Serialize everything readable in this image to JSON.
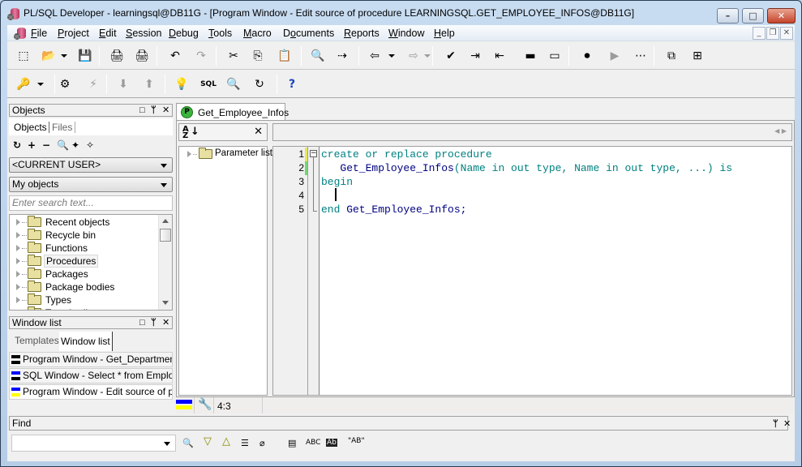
{
  "window": {
    "title": "PL/SQL Developer - learningsql@DB11G - [Program Window - Edit source of procedure LEARNINGSQL.GET_EMPLOYEE_INFOS@DB11G]",
    "controls": {
      "minimize": "–",
      "maximize": "□",
      "close": "✕"
    },
    "mdi_controls": {
      "minimize": "_",
      "restore": "❐",
      "close": "✕"
    }
  },
  "menu": {
    "items": [
      {
        "label": "File",
        "accel": "F"
      },
      {
        "label": "Project",
        "accel": "P"
      },
      {
        "label": "Edit",
        "accel": "E"
      },
      {
        "label": "Session",
        "accel": "S"
      },
      {
        "label": "Debug",
        "accel": "D"
      },
      {
        "label": "Tools",
        "accel": "T"
      },
      {
        "label": "Macro",
        "accel": "M"
      },
      {
        "label": "Documents",
        "accel": "o"
      },
      {
        "label": "Reports",
        "accel": "R"
      },
      {
        "label": "Window",
        "accel": "W"
      },
      {
        "label": "Help",
        "accel": "H"
      }
    ]
  },
  "toolbar1": {
    "buttons": [
      {
        "name": "new-icon",
        "glyph": "⬚",
        "enabled": true
      },
      {
        "name": "open-icon",
        "glyph": "📂",
        "enabled": true
      },
      {
        "name": "save-icon",
        "glyph": "💾",
        "enabled": true
      },
      {
        "name": "print-icon",
        "glyph": "🖨",
        "enabled": true
      },
      {
        "name": "print-preview-icon",
        "glyph": "🖨",
        "enabled": true
      },
      {
        "name": "undo-icon",
        "glyph": "↶",
        "enabled": true
      },
      {
        "name": "redo-icon",
        "glyph": "↷",
        "enabled": false
      },
      {
        "name": "cut-icon",
        "glyph": "✂",
        "enabled": true
      },
      {
        "name": "copy-icon",
        "glyph": "⎘",
        "enabled": true
      },
      {
        "name": "paste-icon",
        "glyph": "📋",
        "enabled": true
      },
      {
        "name": "find-icon",
        "glyph": "🔍",
        "enabled": true
      },
      {
        "name": "find-next-icon",
        "glyph": "⇢",
        "enabled": true
      },
      {
        "name": "back-icon",
        "glyph": "⇦",
        "enabled": true
      },
      {
        "name": "forward-icon",
        "glyph": "⇨",
        "enabled": false
      },
      {
        "name": "compile-icon",
        "glyph": "✔",
        "enabled": true
      },
      {
        "name": "indent-icon",
        "glyph": "⇥",
        "enabled": true
      },
      {
        "name": "unindent-icon",
        "glyph": "⇤",
        "enabled": true
      },
      {
        "name": "comment-icon",
        "glyph": "▬",
        "enabled": true
      },
      {
        "name": "uncomment-icon",
        "glyph": "▭",
        "enabled": true
      },
      {
        "name": "record-macro-icon",
        "glyph": "⏺",
        "enabled": true
      },
      {
        "name": "play-macro-icon",
        "glyph": "▶",
        "enabled": false
      },
      {
        "name": "macro-library-icon",
        "glyph": "⋯",
        "enabled": true
      },
      {
        "name": "cascade-windows-icon",
        "glyph": "⧉",
        "enabled": true
      },
      {
        "name": "tile-windows-icon",
        "glyph": "⊞",
        "enabled": true
      }
    ]
  },
  "toolbar2": {
    "buttons": [
      {
        "name": "logon-key-icon",
        "glyph": "🔑",
        "enabled": true
      },
      {
        "name": "execute-gear-icon",
        "glyph": "⚙",
        "enabled": true
      },
      {
        "name": "break-icon",
        "glyph": "⚡",
        "enabled": false
      },
      {
        "name": "commit-icon",
        "glyph": "⬇",
        "enabled": false
      },
      {
        "name": "rollback-icon",
        "glyph": "⬆",
        "enabled": false
      },
      {
        "name": "explain-plan-icon",
        "glyph": "💡",
        "enabled": true
      },
      {
        "name": "sql-window-icon",
        "glyph": "SQL",
        "enabled": true
      },
      {
        "name": "db-find-icon",
        "glyph": "🔍",
        "enabled": true
      },
      {
        "name": "db-refresh-icon",
        "glyph": "↻",
        "enabled": true
      },
      {
        "name": "help-icon",
        "glyph": "?",
        "enabled": true
      }
    ]
  },
  "objects_panel": {
    "title": "Objects",
    "tabs": [
      "Objects",
      "Files"
    ],
    "active_tab": "Objects",
    "tools": [
      {
        "name": "refresh-icon",
        "glyph": "↻"
      },
      {
        "name": "add-icon",
        "glyph": "+"
      },
      {
        "name": "remove-icon",
        "glyph": "−"
      },
      {
        "name": "find-icon",
        "glyph": "🔍"
      },
      {
        "name": "filter-icon",
        "glyph": "✦"
      },
      {
        "name": "filter-folder-icon",
        "glyph": "✧"
      }
    ],
    "user_select": "<CURRENT USER>",
    "objects_select": "My objects",
    "search_placeholder": "Enter search text...",
    "tree": [
      {
        "label": "Recent objects",
        "selected": false
      },
      {
        "label": "Recycle bin",
        "selected": false
      },
      {
        "label": "Functions",
        "selected": false
      },
      {
        "label": "Procedures",
        "selected": true
      },
      {
        "label": "Packages",
        "selected": false
      },
      {
        "label": "Package bodies",
        "selected": false
      },
      {
        "label": "Types",
        "selected": false
      },
      {
        "label": "Type bodies",
        "selected": false
      }
    ]
  },
  "windowlist_panel": {
    "title": "Window list",
    "tabs": [
      "Templates",
      "Window list"
    ],
    "active_tab": "Window list",
    "items": [
      {
        "label": "Program Window - Get_Department_Infos",
        "top_color": "#000000",
        "bottom_color": "#000000"
      },
      {
        "label": "SQL Window - Select * from Employee",
        "top_color": "#0000ff",
        "bottom_color": "#000000"
      },
      {
        "label": "Program Window - Edit source of procedure",
        "top_color": "#0000ff",
        "bottom_color": "#ffff00"
      }
    ]
  },
  "editor": {
    "tab_label": "Get_Employee_Infos",
    "tab_badge": "P",
    "sort_icon": "A↓Z",
    "clear_icon": "✕",
    "param_tree": [
      {
        "label": "Parameter list"
      }
    ],
    "lines": [
      {
        "num": "1",
        "tokens": [
          {
            "t": "create or replace procedure",
            "c": "kw"
          }
        ],
        "marker": "#e8e850"
      },
      {
        "num": "2",
        "tokens": [
          {
            "t": "   ",
            "c": "id"
          },
          {
            "t": "Get_Employee_Infos",
            "c": "id"
          },
          {
            "t": "(Name in out type, Name in out type, ...) is",
            "c": "kw"
          }
        ],
        "marker": "#70d870"
      },
      {
        "num": "3",
        "tokens": [
          {
            "t": "begin",
            "c": "kw"
          }
        ],
        "marker": ""
      },
      {
        "num": "4",
        "tokens": [
          {
            "t": "",
            "c": "id"
          }
        ],
        "marker": ""
      },
      {
        "num": "5",
        "tokens": [
          {
            "t": "end ",
            "c": "kw"
          },
          {
            "t": "Get_Employee_Infos;",
            "c": "id"
          }
        ],
        "marker": ""
      }
    ],
    "cursor_position": "4:3",
    "colors": {
      "keyword": "#008080",
      "identifier": "#000080"
    }
  },
  "find_bar": {
    "title": "Find",
    "input_value": "",
    "tools": [
      {
        "name": "find-icon",
        "glyph": "🔍"
      },
      {
        "name": "find-next-icon",
        "glyph": "▽"
      },
      {
        "name": "find-previous-icon",
        "glyph": "△"
      },
      {
        "name": "highlight-all-icon",
        "glyph": "☰"
      },
      {
        "name": "clear-highlight-icon",
        "glyph": "⌀"
      },
      {
        "name": "selection-only-icon",
        "glyph": "▤"
      },
      {
        "name": "match-case-icon",
        "glyph": "ABC"
      },
      {
        "name": "whole-word-icon",
        "glyph": "Ab"
      },
      {
        "name": "regex-icon",
        "glyph": "\"AB\""
      }
    ]
  }
}
